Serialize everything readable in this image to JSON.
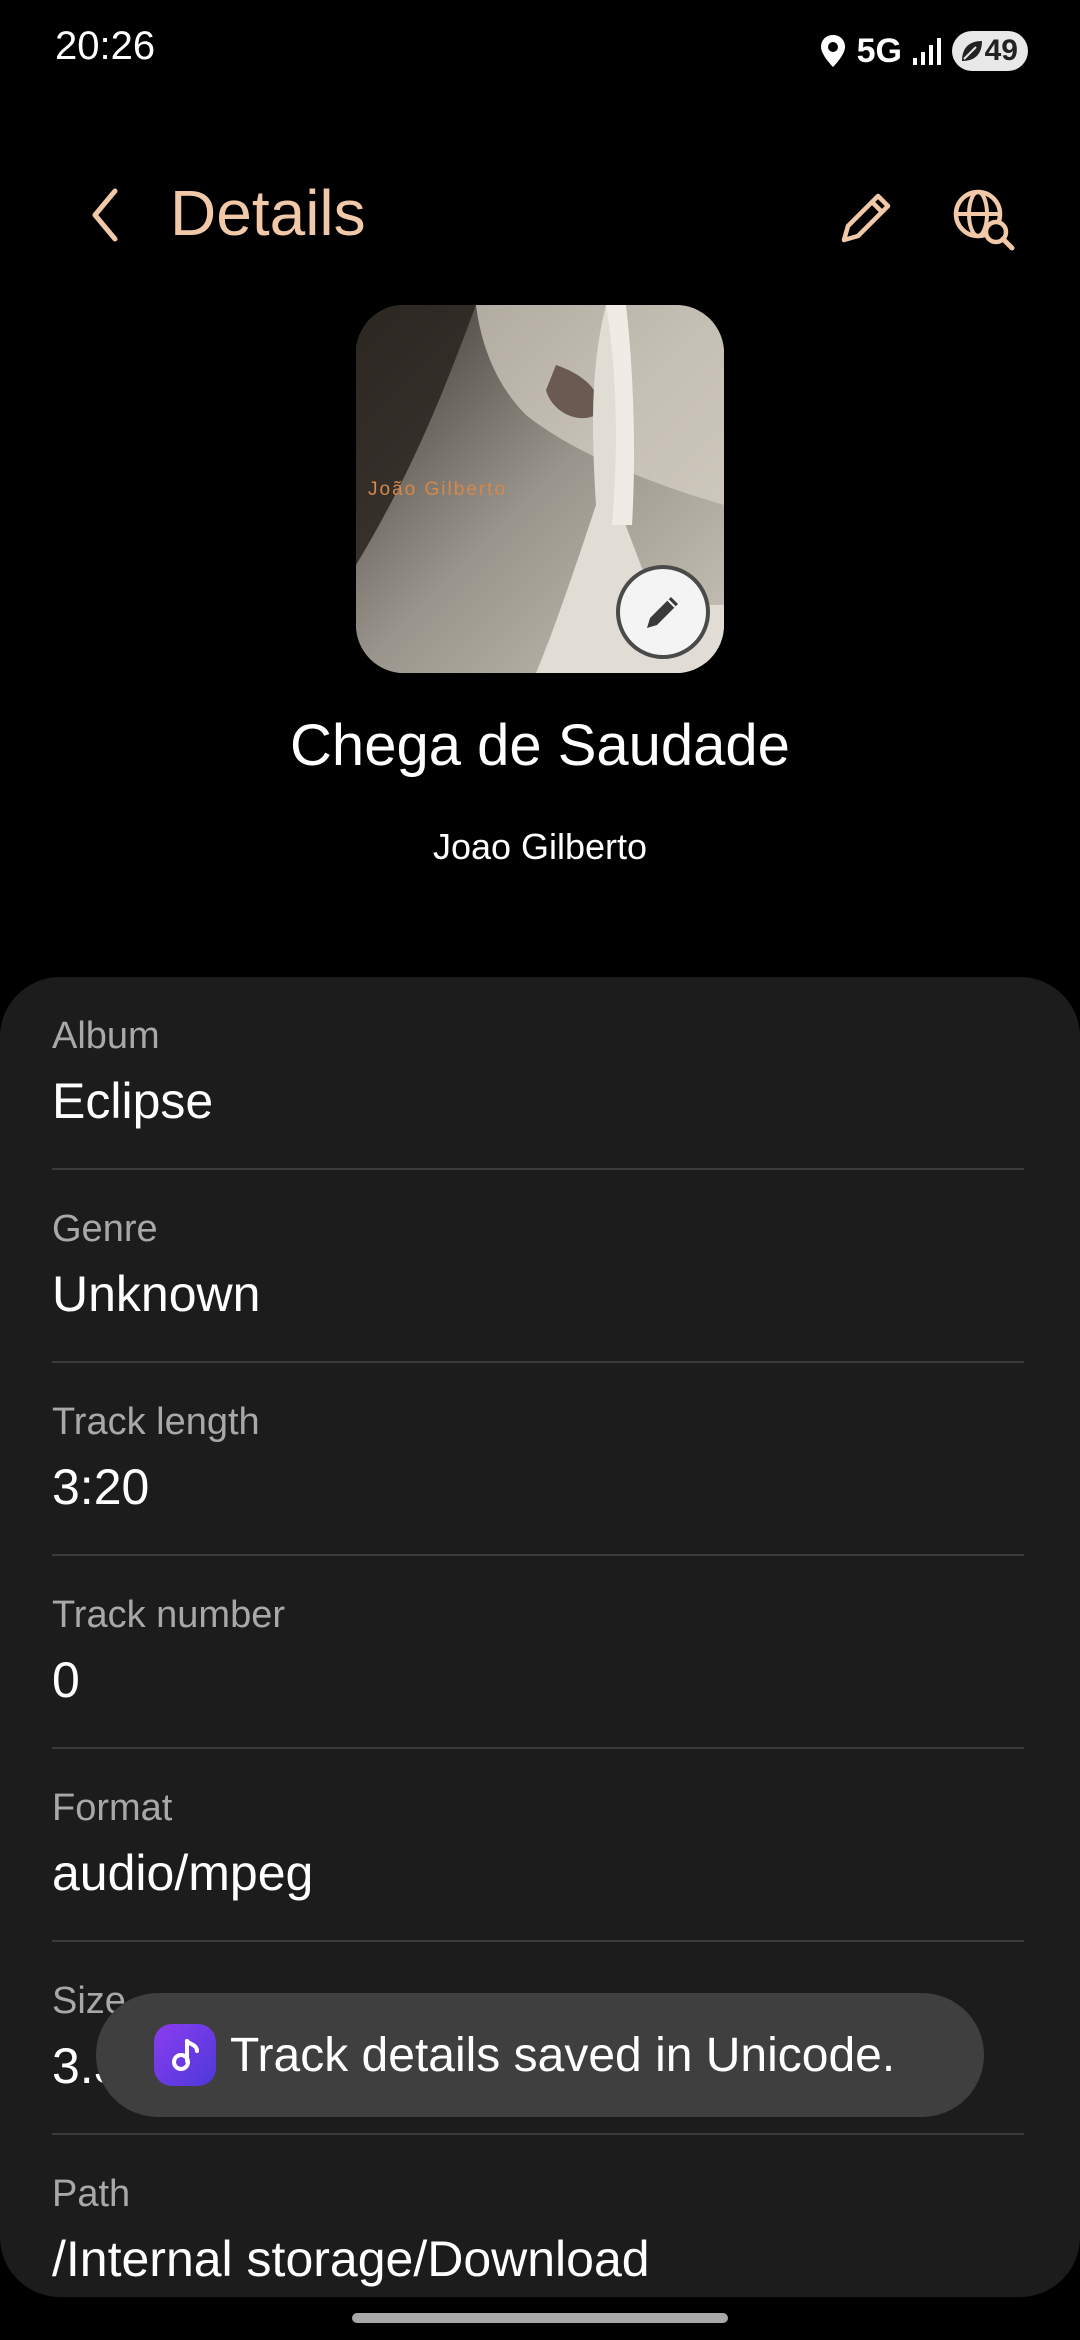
{
  "status_bar": {
    "time": "20:26",
    "network": "5G",
    "battery": "49",
    "icons": [
      "location-icon",
      "signal-icon",
      "battery-icon"
    ]
  },
  "app_bar": {
    "title": "Details",
    "accent_color": "#f2c9a8",
    "icons": [
      "back-icon",
      "edit-icon",
      "web-search-icon"
    ]
  },
  "album_art": {
    "artist_text": "João Gilberto",
    "edit_icon": "pencil-icon"
  },
  "track": {
    "title": "Chega de Saudade",
    "artist": "Joao Gilberto"
  },
  "details": [
    {
      "label": "Album",
      "value": "Eclipse"
    },
    {
      "label": "Genre",
      "value": "Unknown"
    },
    {
      "label": "Track length",
      "value": "3:20"
    },
    {
      "label": "Track number",
      "value": "0"
    },
    {
      "label": "Format",
      "value": "audio/mpeg"
    },
    {
      "label": "Size",
      "value": "3.39 MB"
    },
    {
      "label": "Path",
      "value": "/Internal storage/Download"
    }
  ],
  "toast": {
    "message": "Track details saved in Unicode.",
    "icon": "music-note-icon"
  }
}
